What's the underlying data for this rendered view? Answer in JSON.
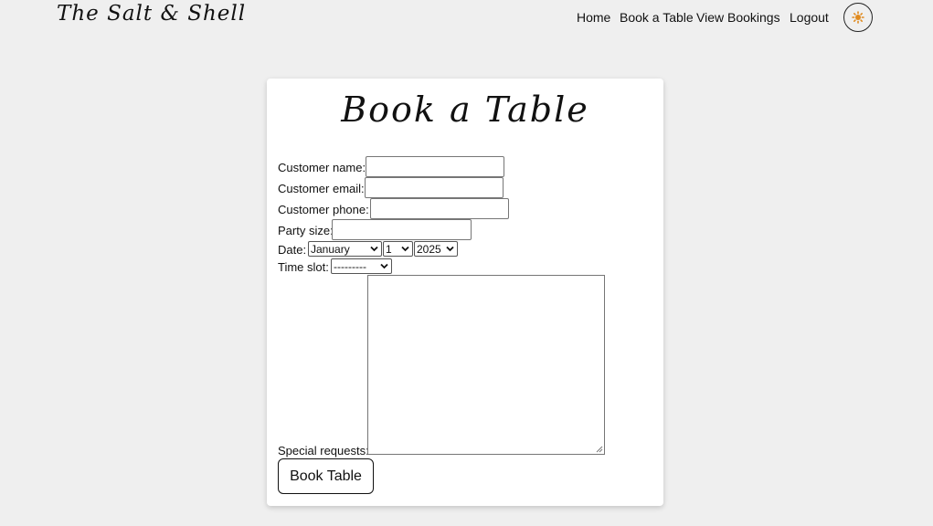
{
  "brand": {
    "logo": "The Salt & Shell"
  },
  "nav": {
    "items": [
      "Home",
      "Book a Table",
      "View Bookings",
      "Logout"
    ],
    "theme_icon": "sun-icon",
    "theme_icon_color": "#e08a1e"
  },
  "form": {
    "title": "Book a Table",
    "labels": {
      "name": "Customer name:",
      "email": "Customer email:",
      "phone": "Customer phone:",
      "party": "Party size:",
      "date": "Date:",
      "time": "Time slot:",
      "requests": "Special requests:"
    },
    "values": {
      "name": "",
      "email": "",
      "phone": "",
      "party": "",
      "requests": ""
    },
    "date": {
      "month": "January",
      "day": "1",
      "year": "2025"
    },
    "time_slot": "---------",
    "submit_label": "Book Table"
  }
}
